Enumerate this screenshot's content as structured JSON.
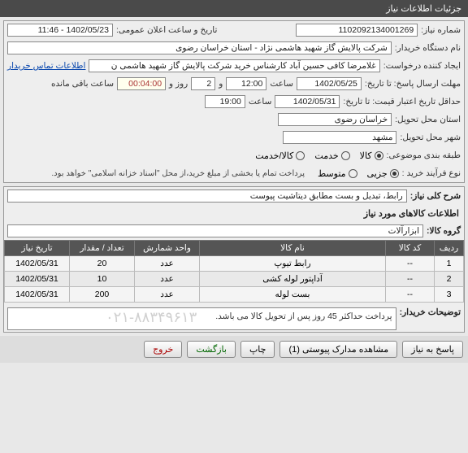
{
  "header": {
    "title": "جزئیات اطلاعات نیاز"
  },
  "info": {
    "need_no_label": "شماره نیاز:",
    "need_no": "1102092134001269",
    "announce_label": "تاریخ و ساعت اعلان عمومی:",
    "announce_value": "1402/05/23 - 11:46",
    "buyer_label": "نام دستگاه خریدار:",
    "buyer_value": "شرکت پالایش گاز شهید هاشمی نژاد - استان خراسان رضوی",
    "requester_label": "ایجاد کننده درخواست:",
    "requester_value": "غلامرضا کافی حسین آباد کارشناس خرید شرکت پالایش گاز شهید هاشمی ن",
    "contact_link": "اطلاعات تماس خریدار",
    "deadline_label": "مهلت ارسال پاسخ: تا تاریخ:",
    "deadline_date": "1402/05/25",
    "saat_label": "ساعت",
    "deadline_time": "12:00",
    "and_label": "و",
    "days_value": "2",
    "rooz_label": "روز و",
    "remain_time": "00:04:00",
    "remain_label": "ساعت باقی مانده",
    "price_valid_label": "حداقل تاریخ اعتبار قیمت: تا تاریخ:",
    "price_valid_date": "1402/05/31",
    "price_valid_time": "19:00",
    "province_label": "استان محل تحویل:",
    "province_value": "خراسان رضوی",
    "city_label": "شهر محل تحویل:",
    "city_value": "مشهد",
    "category_label": "طبقه بندی موضوعی:",
    "cat_goods": "کالا",
    "cat_service": "خدمت",
    "cat_both": "کالا/خدمت",
    "process_label": "نوع فرآیند خرید :",
    "proc_minor": "جزیی",
    "proc_medium": "متوسط",
    "process_note": "پرداخت تمام یا بخشی از مبلغ خرید،از محل \"اسناد خزانه اسلامی\" خواهد بود."
  },
  "desc": {
    "title_label": "شرح کلی نیاز:",
    "title_value": "رابط، تبدیل و بست مطابق دیتاشیت پیوست",
    "goods_section": "اطلاعات کالاهای مورد نیاز",
    "group_label": "گروه کالا:",
    "group_value": "ابزارآلات"
  },
  "table": {
    "headers": [
      "ردیف",
      "کد کالا",
      "نام کالا",
      "واحد شمارش",
      "تعداد / مقدار",
      "تاریخ نیاز"
    ],
    "rows": [
      {
        "n": "1",
        "code": "--",
        "name": "رابط تیوپ",
        "unit": "عدد",
        "qty": "20",
        "date": "1402/05/31"
      },
      {
        "n": "2",
        "code": "--",
        "name": "آداپتور لوله کشی",
        "unit": "عدد",
        "qty": "10",
        "date": "1402/05/31"
      },
      {
        "n": "3",
        "code": "--",
        "name": "بست لوله",
        "unit": "عدد",
        "qty": "200",
        "date": "1402/05/31"
      }
    ]
  },
  "notes": {
    "label": "توضیحات خریدار:",
    "value": "پرداخت حداکثر 45 روز پس از تحویل کالا می باشد."
  },
  "buttons": {
    "respond": "پاسخ به نیاز",
    "attachments": "مشاهده مدارک پیوستی (1)",
    "print": "چاپ",
    "back": "بازگشت",
    "exit": "خروج"
  },
  "watermark": "۰۲۱-۸۸۳۴۹۶۱۳"
}
